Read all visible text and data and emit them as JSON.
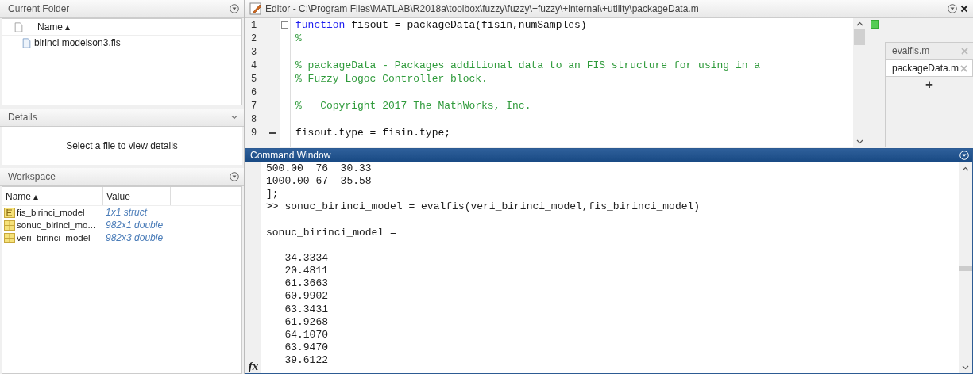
{
  "current_folder": {
    "title": "Current Folder",
    "column": "Name ▴",
    "files": [
      {
        "name": "birinci modelson3.fis"
      }
    ]
  },
  "details": {
    "title": "Details",
    "message": "Select a file to view details"
  },
  "workspace": {
    "title": "Workspace",
    "columns": [
      "Name ▴",
      "Value"
    ],
    "rows": [
      {
        "kind": "struct",
        "name": "fis_birinci_model",
        "value": "1x1 struct"
      },
      {
        "kind": "matrix",
        "name": "sonuc_birinci_mo...",
        "value": "982x1 double"
      },
      {
        "kind": "matrix",
        "name": "veri_birinci_model",
        "value": "982x3 double"
      }
    ]
  },
  "editor": {
    "title": "Editor - C:\\Program Files\\MATLAB\\R2018a\\toolbox\\fuzzy\\fuzzy\\+fuzzy\\+internal\\+utility\\packageData.m",
    "lines": [
      {
        "number": "1",
        "fold": true,
        "breakpoint": false,
        "segments": [
          {
            "kind": "keyword",
            "text": "function"
          },
          {
            "kind": "plain",
            "text": " fisout = packageData(fisin,numSamples)"
          }
        ]
      },
      {
        "number": "2",
        "fold": false,
        "breakpoint": false,
        "segments": [
          {
            "kind": "comment",
            "text": "%"
          }
        ]
      },
      {
        "number": "3",
        "fold": false,
        "breakpoint": false
      },
      {
        "number": "4",
        "fold": false,
        "breakpoint": false,
        "segments": [
          {
            "kind": "comment",
            "text": "% packageData - Packages additional data to an FIS structure for using in a"
          }
        ]
      },
      {
        "number": "5",
        "fold": false,
        "breakpoint": false,
        "segments": [
          {
            "kind": "comment",
            "text": "% Fuzzy Logoc Controller block."
          }
        ]
      },
      {
        "number": "6",
        "fold": false,
        "breakpoint": false
      },
      {
        "number": "7",
        "fold": false,
        "breakpoint": false,
        "segments": [
          {
            "kind": "comment",
            "text": "%   Copyright 2017 The MathWorks, Inc."
          }
        ]
      },
      {
        "number": "8",
        "fold": false,
        "breakpoint": false
      },
      {
        "number": "9",
        "fold": false,
        "breakpoint": true,
        "segments": [
          {
            "kind": "plain",
            "text": "fisout.type = fisin.type;"
          }
        ]
      }
    ],
    "tabs": [
      {
        "label": "evalfis.m",
        "selected": false
      },
      {
        "label": "packageData.m",
        "selected": true
      }
    ],
    "new_tab": "+"
  },
  "command_window": {
    "title": "Command Window",
    "prompt_icon": "fx",
    "lines": [
      {
        "kind": "text",
        "text": "500.00  76  30.33"
      },
      {
        "kind": "text",
        "text": "1000.00 67  35.58"
      },
      {
        "kind": "text",
        "text": "];"
      },
      {
        "kind": "text",
        "text": ">> sonuc_birinci_model = evalfis(veri_birinci_model,fis_birinci_model)"
      },
      {
        "kind": "blank"
      },
      {
        "kind": "text",
        "text": "sonuc_birinci_model ="
      },
      {
        "kind": "blank"
      },
      {
        "kind": "text",
        "text": "   34.3334"
      },
      {
        "kind": "text",
        "text": "   20.4811"
      },
      {
        "kind": "text",
        "text": "   61.3663"
      },
      {
        "kind": "text",
        "text": "   60.9902"
      },
      {
        "kind": "text",
        "text": "   63.3431"
      },
      {
        "kind": "text",
        "text": "   61.9268"
      },
      {
        "kind": "text",
        "text": "   64.1070"
      },
      {
        "kind": "text",
        "text": "   63.9470"
      },
      {
        "kind": "text",
        "text": "   39.6122"
      }
    ]
  }
}
